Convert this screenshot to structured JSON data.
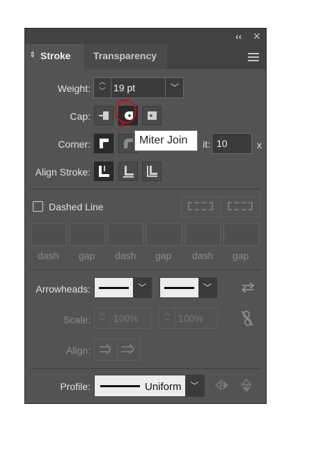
{
  "panel": {
    "tabs": [
      {
        "label": "Stroke"
      },
      {
        "label": "Transparency"
      }
    ],
    "weight": {
      "label": "Weight:",
      "value": "19 pt"
    },
    "cap": {
      "label": "Cap:"
    },
    "corner": {
      "label": "Corner:",
      "limit_label_partial": "it:",
      "limit_value": "10",
      "limit_suffix": "x"
    },
    "align_stroke": {
      "label": "Align Stroke:"
    },
    "dashed_line": {
      "label": "Dashed Line",
      "checked": false,
      "fields": [
        "dash",
        "gap",
        "dash",
        "gap",
        "dash",
        "gap"
      ]
    },
    "arrowheads": {
      "label": "Arrowheads:"
    },
    "scale": {
      "label": "Scale:",
      "start": "100%",
      "end": "100%"
    },
    "align": {
      "label": "Align:"
    },
    "profile": {
      "label": "Profile:",
      "value": "Uniform"
    }
  },
  "tooltip": {
    "text": "Miter Join"
  },
  "icons": [
    "collapse-icon",
    "close-icon",
    "menu-icon",
    "tab-arrows-icon",
    "swap-arrows-icon",
    "link-icon"
  ],
  "colors": {
    "panel_bg": "#535353",
    "annotation": "#c0141c"
  }
}
